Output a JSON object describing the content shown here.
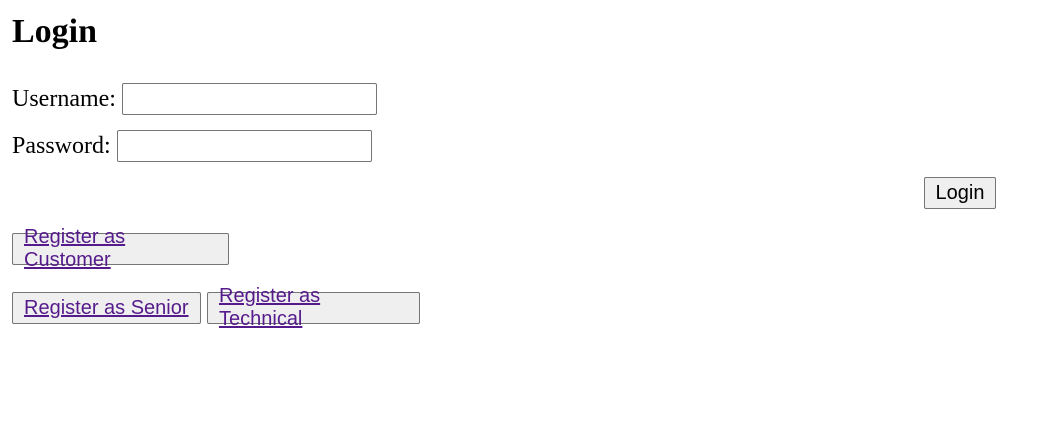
{
  "page": {
    "title": "Login"
  },
  "form": {
    "username_label": "Username:",
    "username_value": "",
    "password_label": "Password:",
    "password_value": "",
    "login_button_label": "Login"
  },
  "register_links": {
    "customer": "Register as Customer",
    "senior": "Register as Senior",
    "technical": "Register as Technical"
  },
  "colors": {
    "link_visited": "#551a8b",
    "button_bg": "#efefef",
    "border": "#767676"
  }
}
